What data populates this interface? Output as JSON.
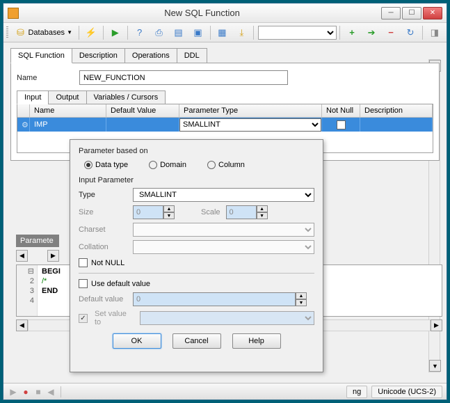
{
  "title": "New SQL Function",
  "toolbar": {
    "databases_label": "Databases"
  },
  "main_tabs": [
    "SQL Function",
    "Description",
    "Operations",
    "DDL"
  ],
  "form": {
    "name_label": "Name",
    "name_value": "NEW_FUNCTION"
  },
  "sub_tabs": [
    "Input",
    "Output",
    "Variables / Cursors"
  ],
  "grid": {
    "headers": [
      "Name",
      "Default Value",
      "Parameter Type",
      "Not Null",
      "Description"
    ],
    "row": {
      "name": "IMP",
      "default": "",
      "type": "SMALLINT",
      "notnull": false,
      "desc": ""
    }
  },
  "popup": {
    "based_on_label": "Parameter based on",
    "radios": [
      "Data type",
      "Domain",
      "Column"
    ],
    "input_param_label": "Input Parameter",
    "type_label": "Type",
    "type_value": "SMALLINT",
    "size_label": "Size",
    "size_value": "0",
    "scale_label": "Scale",
    "scale_value": "0",
    "charset_label": "Charset",
    "collation_label": "Collation",
    "notnull_label": "Not NULL",
    "use_default_label": "Use default value",
    "default_value_label": "Default value",
    "default_value_value": "0",
    "set_value_label": "Set value to",
    "buttons": {
      "ok": "OK",
      "cancel": "Cancel",
      "help": "Help"
    }
  },
  "left_panel": {
    "parameters_hdr": "Paramete"
  },
  "code": {
    "lines": [
      "BEGI",
      "  /*",
      "",
      "END"
    ],
    "visible_line_nums": [
      "",
      "2",
      "3",
      "4"
    ]
  },
  "statusbar": {
    "item1": "ng",
    "item2": "Unicode (UCS-2)"
  }
}
